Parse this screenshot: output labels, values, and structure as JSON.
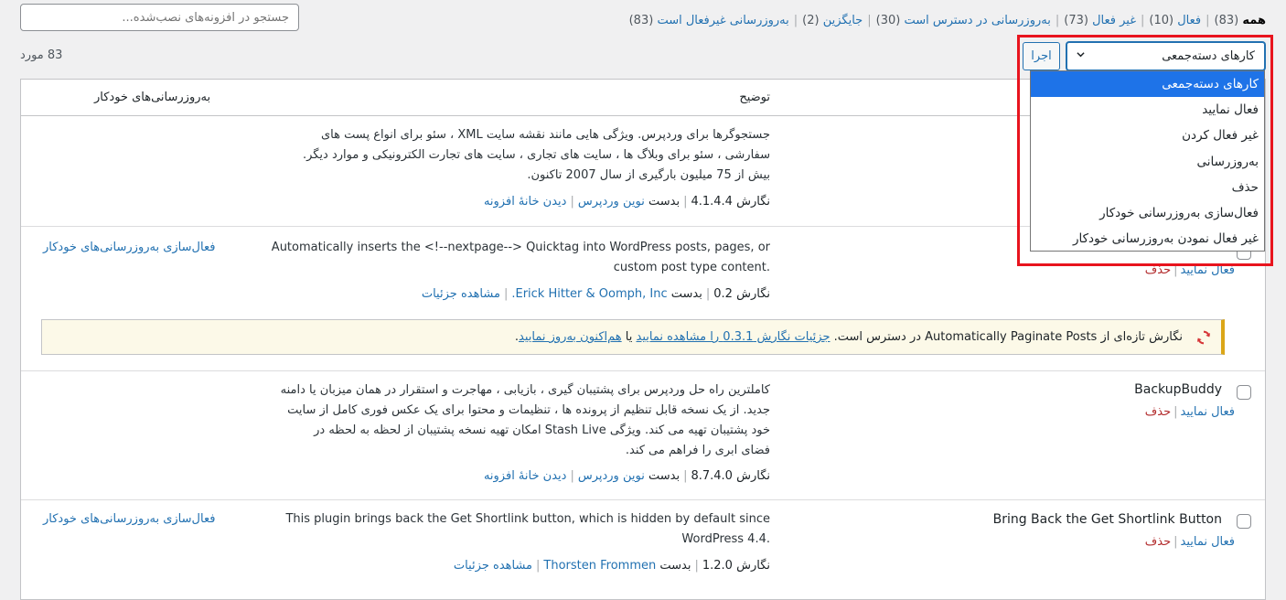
{
  "filters": {
    "all": {
      "label": "همه",
      "count": "(83)"
    },
    "active": {
      "label": "فعال",
      "count": "(10)"
    },
    "inactive": {
      "label": "غیر فعال",
      "count": "(73)"
    },
    "update_available": {
      "label": "به‌روزرسانی در دسترس است",
      "count": "(30)"
    },
    "dropins": {
      "label": "جایگزین",
      "count": "(2)"
    },
    "autoupdate_disabled": {
      "label": "به‌روزرسانی غیرفعال است",
      "count": "(83)"
    }
  },
  "search": {
    "placeholder": "جستجو در افزونه‌های نصب‌شده..."
  },
  "items_count": "83 مورد",
  "bulk": {
    "selected": "کارهای دسته‌جمعی",
    "apply_label": "اجرا",
    "options": [
      "کارهای دسته‌جمعی",
      "فعال نمایید",
      "غیر فعال کردن",
      "به‌روزرسانی",
      "حذف",
      "فعال‌سازی به‌روزرسانی خودکار",
      "غیر فعال نمودن به‌روزرسانی خودکار"
    ]
  },
  "table": {
    "col_description": "توضیح",
    "col_autoupdate": "به‌روزرسانی‌های خودکار",
    "rows": [
      {
        "desc_lines": [
          "جستجوگرها برای وردپرس. ویژگی هایی مانند نقشه سایت XML ، سئو برای انواع پست های",
          "سفارشی ، سئو برای وبلاگ ها ، سایت های تجاری ، سایت های تجارت الکترونیکی و موارد دیگر.",
          "بیش از 75 میلیون بارگیری از سال 2007 تاکنون."
        ],
        "version": "نگارش 4.1.4.4",
        "by": "بدست",
        "author": "نوین وردپرس",
        "link": "دیدن خانهٔ افزونه"
      },
      {
        "desc_lines": [
          "Automatically inserts the <!--nextpage--> Quicktag into WordPress posts, pages, or",
          "custom post type content."
        ],
        "version": "نگارش 0.2",
        "by": "بدست",
        "author": "Erick Hitter & Oomph, Inc.",
        "link": "مشاهده جزئیات",
        "autoupdate": "فعال‌سازی به‌روزرسانی‌های خودکار",
        "activate": "فعال نمایید",
        "delete": "حذف"
      },
      {
        "name": "BackupBuddy",
        "desc_lines": [
          "کاملترین راه حل وردپرس برای پشتیبان گیری ، بازیابی ، مهاجرت و استقرار در همان میزبان یا دامنه",
          "جدید. از یک نسخه قابل تنظیم از پرونده ها ، تنظیمات و محتوا برای یک عکس فوری کامل از سایت",
          "خود پشتیبان تهیه می کند. ویژگی Stash Live امکان تهیه نسخه پشتیبان از لحظه به لحظه در",
          "فضای ابری را فراهم می کند."
        ],
        "version": "نگارش 8.7.4.0",
        "by": "بدست",
        "author": "نوین وردپرس",
        "link": "دیدن خانهٔ افزونه",
        "activate": "فعال نمایید",
        "delete": "حذف"
      },
      {
        "name": "Bring Back the Get Shortlink Button",
        "desc_lines": [
          "This plugin brings back the Get Shortlink button, which is hidden by default since",
          "WordPress 4.4."
        ],
        "version": "نگارش 1.2.0",
        "by": "بدست",
        "author": "Thorsten Frommen",
        "link": "مشاهده جزئیات",
        "autoupdate": "فعال‌سازی به‌روزرسانی‌های خودکار",
        "activate": "فعال نمایید",
        "delete": "حذف"
      }
    ]
  },
  "notice": {
    "prefix": "نگارش تازه‌ای از Automatically Paginate Posts در دسترس است.",
    "details_link": "جزئیات نگارش 0.3.1 را مشاهده نمایید",
    "or": "یا",
    "update_link": "هم‌اکنون به‌روز نمایید",
    "suffix": ".",
    "icon": "update-icon"
  },
  "colors": {
    "accent": "#2271b1",
    "highlight": "#e8141e",
    "delete": "#b32d2e",
    "notice_border": "#dba617"
  }
}
